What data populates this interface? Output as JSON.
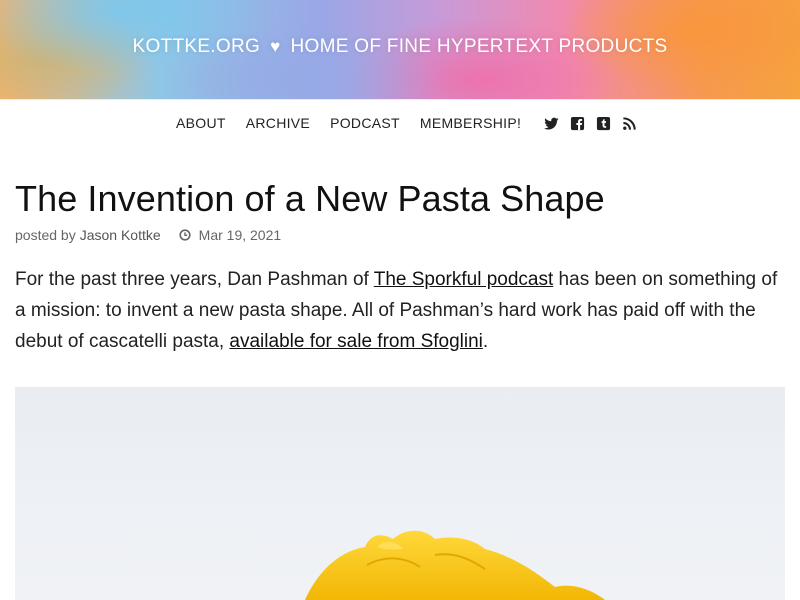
{
  "site": {
    "title_left": "KOTTKE.ORG",
    "heart": "♥",
    "title_right": "HOME OF FINE HYPERTEXT PRODUCTS"
  },
  "nav": {
    "links": [
      "ABOUT",
      "ARCHIVE",
      "PODCAST",
      "MEMBERSHIP!"
    ],
    "icons": [
      "twitter-icon",
      "facebook-icon",
      "tumblr-icon",
      "rss-icon"
    ]
  },
  "post": {
    "title": "The Invention of a New Pasta Shape",
    "posted_by_label": "posted by",
    "author": "Jason Kottke",
    "date": "Mar 19, 2021",
    "para_1": "For the past three years, Dan Pashman of ",
    "link_1": "The Sporkful podcast",
    "para_2": " has been on something of a mission: to invent a new pasta shape. All of Pashman’s hard work has paid off with the debut of cascatelli pasta, ",
    "link_2": "available for sale from Sfoglini",
    "para_3": "."
  },
  "colors": {
    "pasta": "#f5c518",
    "photo_bg": "#ebeff3"
  }
}
